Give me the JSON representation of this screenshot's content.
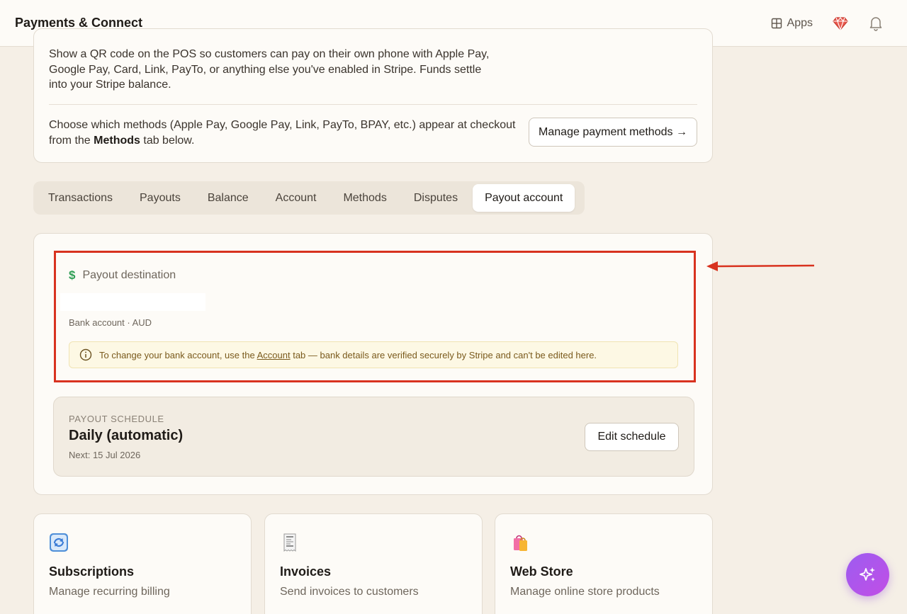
{
  "header": {
    "title": "Payments & Connect",
    "apps_label": "Apps"
  },
  "intro": {
    "description": "Show a QR code on the POS so customers can pay on their own phone with Apple Pay, Google Pay, Card, Link, PayTo, or anything else you've enabled in Stripe. Funds settle into your Stripe balance.",
    "choose_prefix": "Choose which methods (Apple Pay, Google Pay, Link, PayTo, BPAY, etc.) appear at checkout from the ",
    "choose_bold": "Methods",
    "choose_suffix": " tab below.",
    "manage_button": "Manage payment methods →"
  },
  "tabs": [
    {
      "label": "Transactions",
      "active": false
    },
    {
      "label": "Payouts",
      "active": false
    },
    {
      "label": "Balance",
      "active": false
    },
    {
      "label": "Account",
      "active": false
    },
    {
      "label": "Methods",
      "active": false
    },
    {
      "label": "Disputes",
      "active": false
    },
    {
      "label": "Payout account",
      "active": true
    }
  ],
  "payout_destination": {
    "icon": "$",
    "label": "Payout destination",
    "bank_meta": "Bank account · AUD",
    "notice_prefix": "To change your bank account, use the ",
    "notice_link": "Account",
    "notice_suffix": " tab — bank details are verified securely by Stripe and can't be edited here."
  },
  "schedule": {
    "kicker": "PAYOUT SCHEDULE",
    "value": "Daily (automatic)",
    "next": "Next: 15 Jul 2026",
    "edit_button": "Edit schedule"
  },
  "features": [
    {
      "icon": "repeat-icon",
      "title": "Subscriptions",
      "desc": "Manage recurring billing"
    },
    {
      "icon": "receipt-icon",
      "title": "Invoices",
      "desc": "Send invoices to customers"
    },
    {
      "icon": "shopping-bags-icon",
      "title": "Web Store",
      "desc": "Manage online store products"
    }
  ],
  "colors": {
    "highlight": "#d8321f",
    "accent_purple": "#9d5cf0",
    "success_green": "#2f9e55"
  }
}
